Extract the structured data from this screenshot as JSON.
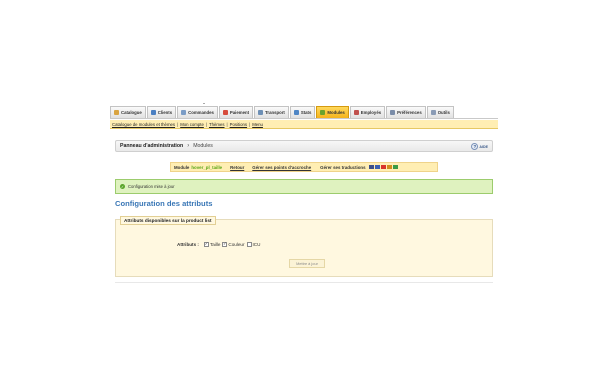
{
  "tabs": [
    {
      "label": "Catalogue",
      "icon": "catalog-icon",
      "icon_color": "#d9a441",
      "active": false
    },
    {
      "label": "Clients",
      "icon": "customers-icon",
      "icon_color": "#4a7fc2",
      "active": false
    },
    {
      "label": "Commandes",
      "icon": "orders-icon",
      "icon_color": "#7a9cc6",
      "active": false
    },
    {
      "label": "Paiement",
      "icon": "payment-icon",
      "icon_color": "#d64b3c",
      "active": false
    },
    {
      "label": "Transport",
      "icon": "shipping-icon",
      "icon_color": "#6d8fb5",
      "active": false
    },
    {
      "label": "Stats",
      "icon": "stats-icon",
      "icon_color": "#4f86c5",
      "active": false
    },
    {
      "label": "Modules",
      "icon": "modules-icon",
      "icon_color": "#6aa22d",
      "active": true
    },
    {
      "label": "Employés",
      "icon": "employees-icon",
      "icon_color": "#c0504d",
      "active": false
    },
    {
      "label": "Préférences",
      "icon": "preferences-icon",
      "icon_color": "#7a8ca8",
      "active": false
    },
    {
      "label": "Outils",
      "icon": "tools-icon",
      "icon_color": "#8a9bb5",
      "active": false
    }
  ],
  "submenu": [
    "Catalogue de modules et thèmes",
    "Mon compte",
    "Thèmes",
    "Positions",
    "Menu"
  ],
  "breadcrumb": {
    "root": "Panneau d'administration",
    "current": "Modules"
  },
  "help_label": "AIDE",
  "module_bar": {
    "module_label": "Module",
    "module_name": "hover_pl_taille",
    "back_link": "Retour",
    "hooks_link": "Gérer ses points d'accroche",
    "translations_label": "Gérer ses traductions",
    "flags": [
      {
        "name": "en-flag",
        "color": "#3c4f8a"
      },
      {
        "name": "fr-flag",
        "color": "#3b5fb0"
      },
      {
        "name": "es-flag",
        "color": "#d9342b"
      },
      {
        "name": "de-flag",
        "color": "#d28c1e"
      },
      {
        "name": "it-flag",
        "color": "#3a9b46"
      }
    ]
  },
  "confirmation": "Configuration mise à jour",
  "section_title": "Configuration des attributs",
  "fieldset": {
    "legend": "Attributs disponibles sur la product list",
    "attributes_label": "Attributs :",
    "options": [
      {
        "label": "Taille",
        "checked": true
      },
      {
        "label": "Couleur",
        "checked": true
      },
      {
        "label": "ICU",
        "checked": false
      }
    ],
    "submit_label": "Mettre à jour"
  },
  "colors": {
    "accent_blue": "#3a77b6",
    "active_tab": "#f5b31c",
    "success_bg": "#dff2bf",
    "submenu_bg": "#ffeeb3"
  }
}
